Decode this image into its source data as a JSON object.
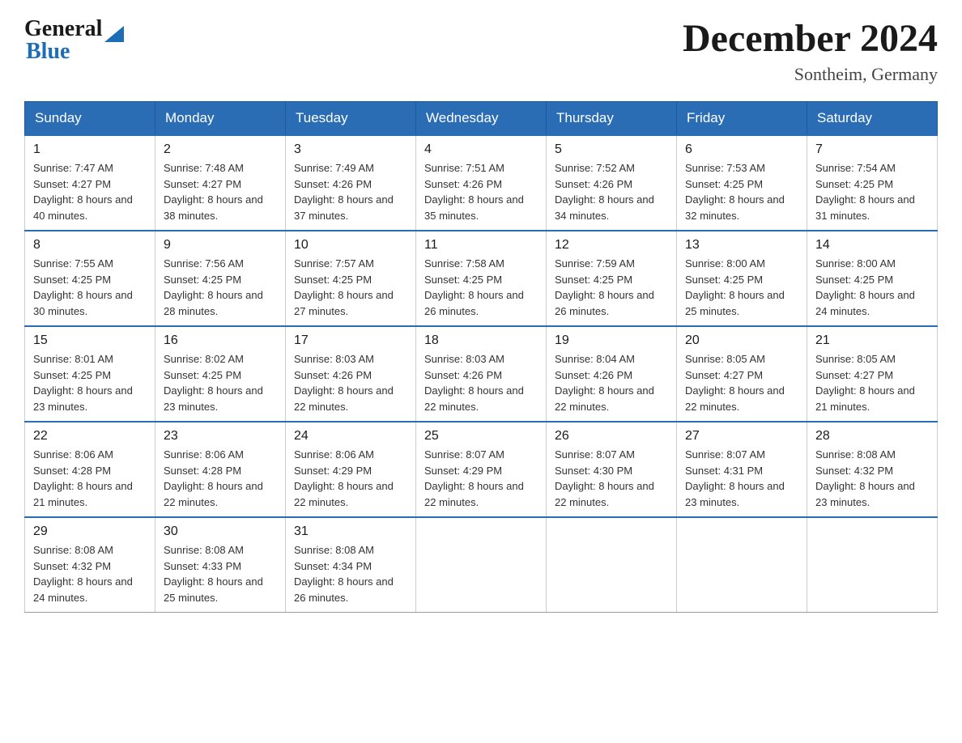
{
  "logo": {
    "general": "General",
    "blue": "Blue"
  },
  "title": {
    "month": "December 2024",
    "location": "Sontheim, Germany"
  },
  "headers": [
    "Sunday",
    "Monday",
    "Tuesday",
    "Wednesday",
    "Thursday",
    "Friday",
    "Saturday"
  ],
  "weeks": [
    [
      {
        "day": "1",
        "sunrise": "7:47 AM",
        "sunset": "4:27 PM",
        "daylight": "8 hours and 40 minutes."
      },
      {
        "day": "2",
        "sunrise": "7:48 AM",
        "sunset": "4:27 PM",
        "daylight": "8 hours and 38 minutes."
      },
      {
        "day": "3",
        "sunrise": "7:49 AM",
        "sunset": "4:26 PM",
        "daylight": "8 hours and 37 minutes."
      },
      {
        "day": "4",
        "sunrise": "7:51 AM",
        "sunset": "4:26 PM",
        "daylight": "8 hours and 35 minutes."
      },
      {
        "day": "5",
        "sunrise": "7:52 AM",
        "sunset": "4:26 PM",
        "daylight": "8 hours and 34 minutes."
      },
      {
        "day": "6",
        "sunrise": "7:53 AM",
        "sunset": "4:25 PM",
        "daylight": "8 hours and 32 minutes."
      },
      {
        "day": "7",
        "sunrise": "7:54 AM",
        "sunset": "4:25 PM",
        "daylight": "8 hours and 31 minutes."
      }
    ],
    [
      {
        "day": "8",
        "sunrise": "7:55 AM",
        "sunset": "4:25 PM",
        "daylight": "8 hours and 30 minutes."
      },
      {
        "day": "9",
        "sunrise": "7:56 AM",
        "sunset": "4:25 PM",
        "daylight": "8 hours and 28 minutes."
      },
      {
        "day": "10",
        "sunrise": "7:57 AM",
        "sunset": "4:25 PM",
        "daylight": "8 hours and 27 minutes."
      },
      {
        "day": "11",
        "sunrise": "7:58 AM",
        "sunset": "4:25 PM",
        "daylight": "8 hours and 26 minutes."
      },
      {
        "day": "12",
        "sunrise": "7:59 AM",
        "sunset": "4:25 PM",
        "daylight": "8 hours and 26 minutes."
      },
      {
        "day": "13",
        "sunrise": "8:00 AM",
        "sunset": "4:25 PM",
        "daylight": "8 hours and 25 minutes."
      },
      {
        "day": "14",
        "sunrise": "8:00 AM",
        "sunset": "4:25 PM",
        "daylight": "8 hours and 24 minutes."
      }
    ],
    [
      {
        "day": "15",
        "sunrise": "8:01 AM",
        "sunset": "4:25 PM",
        "daylight": "8 hours and 23 minutes."
      },
      {
        "day": "16",
        "sunrise": "8:02 AM",
        "sunset": "4:25 PM",
        "daylight": "8 hours and 23 minutes."
      },
      {
        "day": "17",
        "sunrise": "8:03 AM",
        "sunset": "4:26 PM",
        "daylight": "8 hours and 22 minutes."
      },
      {
        "day": "18",
        "sunrise": "8:03 AM",
        "sunset": "4:26 PM",
        "daylight": "8 hours and 22 minutes."
      },
      {
        "day": "19",
        "sunrise": "8:04 AM",
        "sunset": "4:26 PM",
        "daylight": "8 hours and 22 minutes."
      },
      {
        "day": "20",
        "sunrise": "8:05 AM",
        "sunset": "4:27 PM",
        "daylight": "8 hours and 22 minutes."
      },
      {
        "day": "21",
        "sunrise": "8:05 AM",
        "sunset": "4:27 PM",
        "daylight": "8 hours and 21 minutes."
      }
    ],
    [
      {
        "day": "22",
        "sunrise": "8:06 AM",
        "sunset": "4:28 PM",
        "daylight": "8 hours and 21 minutes."
      },
      {
        "day": "23",
        "sunrise": "8:06 AM",
        "sunset": "4:28 PM",
        "daylight": "8 hours and 22 minutes."
      },
      {
        "day": "24",
        "sunrise": "8:06 AM",
        "sunset": "4:29 PM",
        "daylight": "8 hours and 22 minutes."
      },
      {
        "day": "25",
        "sunrise": "8:07 AM",
        "sunset": "4:29 PM",
        "daylight": "8 hours and 22 minutes."
      },
      {
        "day": "26",
        "sunrise": "8:07 AM",
        "sunset": "4:30 PM",
        "daylight": "8 hours and 22 minutes."
      },
      {
        "day": "27",
        "sunrise": "8:07 AM",
        "sunset": "4:31 PM",
        "daylight": "8 hours and 23 minutes."
      },
      {
        "day": "28",
        "sunrise": "8:08 AM",
        "sunset": "4:32 PM",
        "daylight": "8 hours and 23 minutes."
      }
    ],
    [
      {
        "day": "29",
        "sunrise": "8:08 AM",
        "sunset": "4:32 PM",
        "daylight": "8 hours and 24 minutes."
      },
      {
        "day": "30",
        "sunrise": "8:08 AM",
        "sunset": "4:33 PM",
        "daylight": "8 hours and 25 minutes."
      },
      {
        "day": "31",
        "sunrise": "8:08 AM",
        "sunset": "4:34 PM",
        "daylight": "8 hours and 26 minutes."
      },
      null,
      null,
      null,
      null
    ]
  ]
}
